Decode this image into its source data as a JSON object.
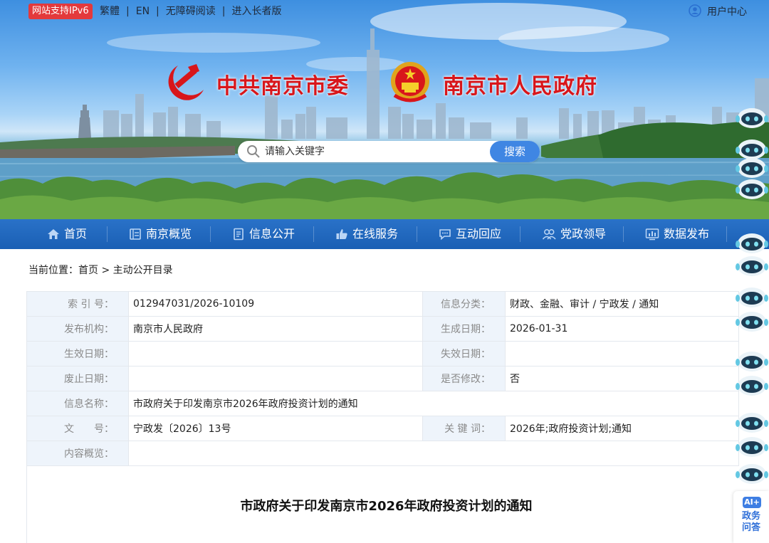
{
  "topbar": {
    "ipv6_badge": "网站支持IPv6",
    "links": [
      "繁體",
      "EN",
      "无障碍阅读",
      "进入长者版"
    ],
    "separator": "|",
    "user_center": "用户中心"
  },
  "banner": {
    "party_name": "中共南京市委",
    "gov_name": "南京市人民政府"
  },
  "search": {
    "placeholder": "请输入关键字",
    "button": "搜索"
  },
  "nav": {
    "items": [
      {
        "label": "首页",
        "icon": "home-icon"
      },
      {
        "label": "南京概览",
        "icon": "overview-icon"
      },
      {
        "label": "信息公开",
        "icon": "document-icon"
      },
      {
        "label": "在线服务",
        "icon": "thumbs-up-icon"
      },
      {
        "label": "互动回应",
        "icon": "chat-icon"
      },
      {
        "label": "党政领导",
        "icon": "leaders-icon"
      },
      {
        "label": "数据发布",
        "icon": "chart-icon"
      }
    ]
  },
  "breadcrumb": {
    "prefix": "当前位置：",
    "home": "首页",
    "arrow": ">",
    "current": "主动公开目录"
  },
  "info": {
    "index_no_label": "索 引 号：",
    "index_no": "012947031/2026-10109",
    "category_label": "信息分类：",
    "category": "财政、金融、审计 / 宁政发 / 通知",
    "publisher_label": "发布机构：",
    "publisher": "南京市人民政府",
    "created_label": "生成日期：",
    "created": "2026-01-31",
    "effective_label": "生效日期：",
    "effective": "",
    "expire_label": "失效日期：",
    "expire": "",
    "abolish_label": "废止日期：",
    "abolish": "",
    "modified_label": "是否修改：",
    "modified": "否",
    "name_label": "信息名称：",
    "name": "市政府关于印发南京市2026年政府投资计划的通知",
    "doc_no_label": "文　　号：",
    "doc_no": "宁政发〔2026〕13号",
    "keywords_label": "关 键 词：",
    "keywords": "2026年;政府投资计划;通知",
    "summary_label": "内容概览：",
    "summary": ""
  },
  "document": {
    "title": "市政府关于印发南京市2026年政府投资计划的通知"
  },
  "ai_assistant": {
    "logo": "AI+",
    "label": "政务问答"
  },
  "colors": {
    "nav_blue": "#1a5fb4",
    "brand_red": "#d8161b",
    "ipv6_red": "#e3393c",
    "search_button": "#3f86e3",
    "label_cell_bg": "#eef4fb"
  }
}
